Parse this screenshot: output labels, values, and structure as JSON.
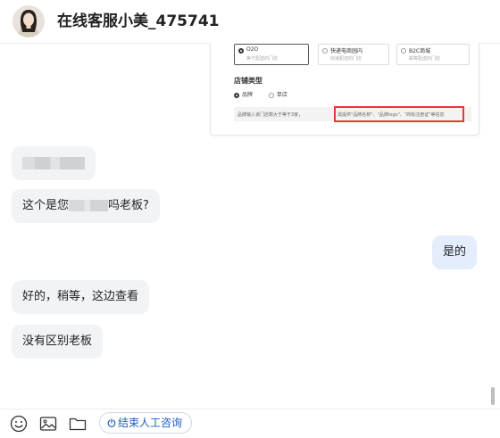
{
  "header": {
    "title": "在线客服小美_475741"
  },
  "shared_screenshot": {
    "options": [
      {
        "label": "O2O",
        "desc": "等于配送的门店",
        "selected": true
      },
      {
        "label": "快递电商园内",
        "desc": "快递配送的门店",
        "selected": false
      },
      {
        "label": "B2C商城",
        "desc": "邮寄配送的门店",
        "selected": false
      }
    ],
    "section_title": "店铺类型",
    "radio_options": [
      {
        "label": "品牌",
        "selected": true
      },
      {
        "label": "单店",
        "selected": false
      }
    ],
    "hint_left": "品牌输入该门店数大于等于3家，",
    "hint_highlight": "需提供\"品牌名称\"、\"品牌logo\"、\"商标注册证\"等信息"
  },
  "messages": [
    {
      "side": "incoming",
      "text": ""
    },
    {
      "side": "incoming",
      "text_before": "这个是您",
      "text_after": "吗老板?"
    },
    {
      "side": "outgoing",
      "text": "是的"
    },
    {
      "side": "incoming",
      "text": "好的，稍等，这边查看"
    },
    {
      "side": "incoming",
      "text": "没有区别老板"
    }
  ],
  "footer": {
    "icons": [
      "emoji-icon",
      "image-icon",
      "folder-icon"
    ],
    "end_button_label": "结束人工咨询"
  },
  "colors": {
    "incoming_bubble": "#f2f3f5",
    "outgoing_bubble": "#e3edfb",
    "highlight_box": "#e53935",
    "link_blue": "#1f5fbf"
  }
}
